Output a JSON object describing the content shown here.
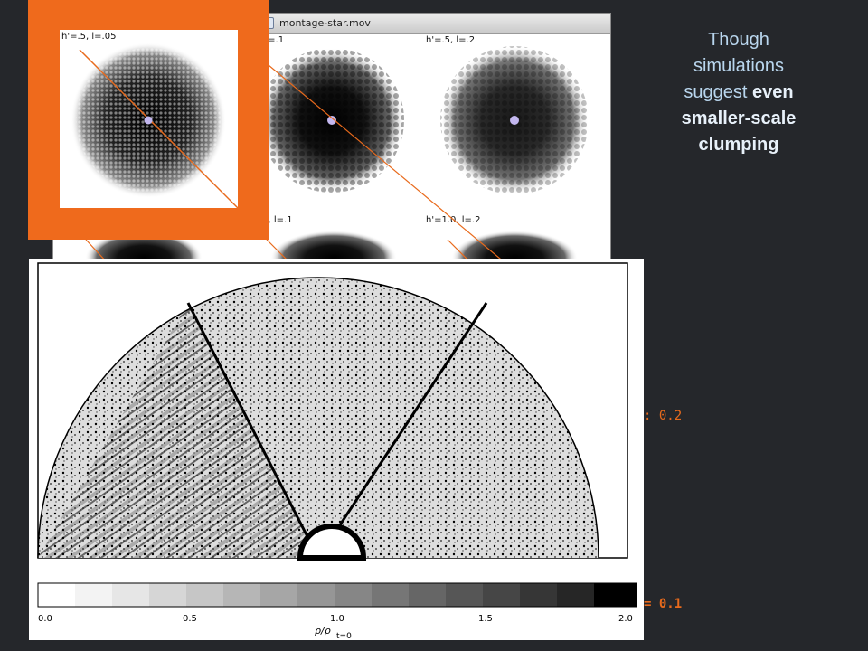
{
  "window": {
    "title": "montage-star.mov"
  },
  "panels": [
    {
      "caption": "h'=.5, l=.05"
    },
    {
      "caption": ", l=.1"
    },
    {
      "caption": "h'=.5, l=.2"
    },
    {
      "caption": ".0, l=.1"
    },
    {
      "caption": "h'=1.0, l=.2"
    }
  ],
  "side_text": {
    "line1": "Though simulations suggest ",
    "bold": "even smaller-scale clumping"
  },
  "notes": {
    "upper": ": 0.2",
    "lower": "= 0.1"
  },
  "colorbar": {
    "ticks": [
      "0.0",
      "0.5",
      "1.0",
      "1.5",
      "2.0"
    ],
    "label": "ρ/ρ",
    "label_sub": "t=0"
  },
  "colors": {
    "accent": "#ef6a1c",
    "background": "#25272b",
    "heading": "#b9d6ee"
  }
}
